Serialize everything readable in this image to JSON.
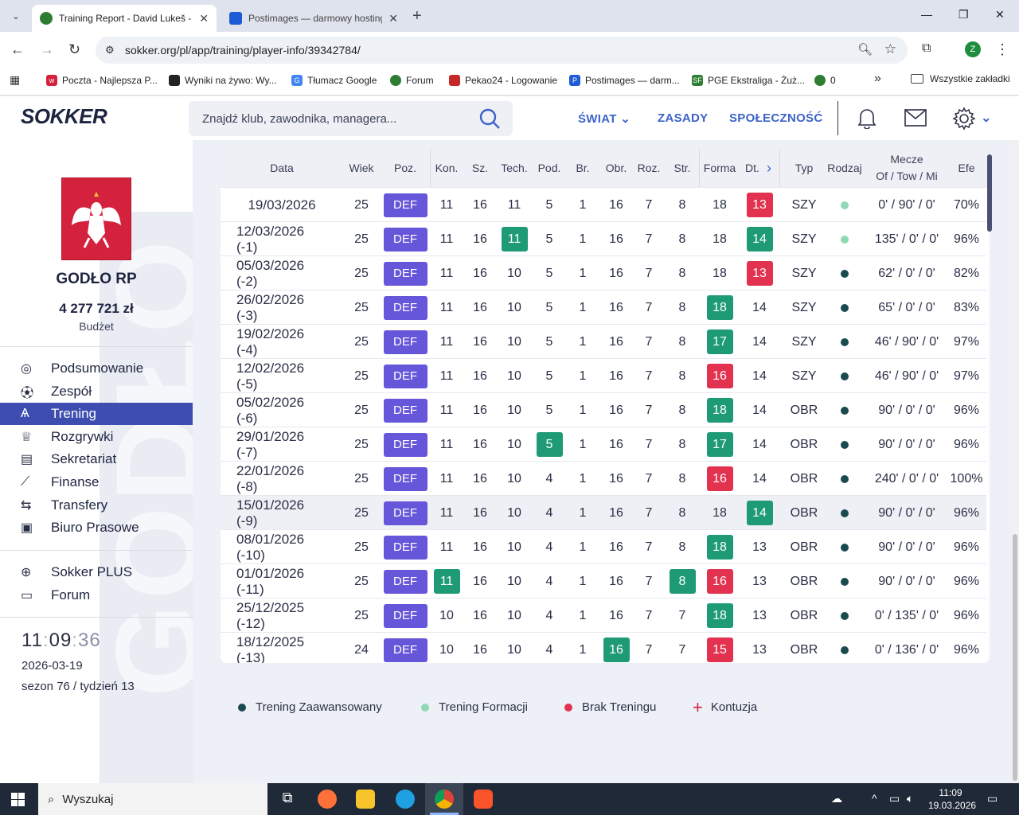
{
  "browser": {
    "tabs": [
      {
        "title": "Training Report - David Lukeš -",
        "active": true
      },
      {
        "title": "Postimages — darmowy hosting",
        "active": false
      }
    ],
    "url": "sokker.org/pl/app/training/player-info/39342784/",
    "profile_initial": "Z",
    "bookmarks": [
      {
        "label": "Poczta - Najlepsza P...",
        "color": "#d4213d",
        "icon": "mail-icon"
      },
      {
        "label": "Wyniki na żywo: Wy...",
        "color": "#222222",
        "icon": "scores-icon"
      },
      {
        "label": "Tłumacz Google",
        "color": "#4285f4",
        "icon": "translate-icon"
      },
      {
        "label": "Forum",
        "color": "#2e7d32",
        "icon": "forum-icon"
      },
      {
        "label": "Pekao24 - Logowanie",
        "color": "#c62828",
        "icon": "bank-icon"
      },
      {
        "label": "Postimages — darm...",
        "color": "#1e5bd6",
        "icon": "postimages-icon"
      },
      {
        "label": "PGE Ekstraliga - Żuż...",
        "color": "#2e7d32",
        "icon": "pge-icon"
      },
      {
        "label": "0",
        "color": "#2e7d32",
        "icon": "sokker-icon"
      }
    ],
    "all_bookmarks": "Wszystkie zakładki"
  },
  "site": {
    "logo": "SOKKER",
    "search_placeholder": "Znajdź klub, zawodnika, managera...",
    "nav": [
      "ŚWIAT",
      "ZASADY",
      "SPOŁECZNOŚĆ"
    ]
  },
  "sidebar": {
    "watermark": "GODŁO",
    "club_name": "GODŁO RP",
    "budget": "4 277 721 zł",
    "budget_label": "Budżet",
    "menu": [
      {
        "label": "Podsumowanie",
        "icon": "summary-icon",
        "active": false
      },
      {
        "label": "Zespół",
        "icon": "ball-icon",
        "active": false
      },
      {
        "label": "Trening",
        "icon": "training-icon",
        "active": true
      },
      {
        "label": "Rozgrywki",
        "icon": "trophy-icon",
        "active": false
      },
      {
        "label": "Sekretariat",
        "icon": "office-icon",
        "active": false
      },
      {
        "label": "Finanse",
        "icon": "chart-icon",
        "active": false
      },
      {
        "label": "Transfery",
        "icon": "transfer-icon",
        "active": false
      },
      {
        "label": "Biuro Prasowe",
        "icon": "press-icon",
        "active": false
      }
    ],
    "menu2": [
      {
        "label": "Sokker PLUS",
        "icon": "plus-circle-icon"
      },
      {
        "label": "Forum",
        "icon": "forum-icon"
      }
    ],
    "clock": {
      "h": "11",
      "m": "09",
      "s": "36"
    },
    "date": "2026-03-19",
    "season": "sezon 76 / tydzień 13"
  },
  "table": {
    "headers": {
      "date": "Data",
      "age": "Wiek",
      "pos": "Poz.",
      "kon": "Kon.",
      "sz": "Sz.",
      "tech": "Tech.",
      "pod": "Pod.",
      "br": "Br.",
      "obr": "Obr.",
      "roz": "Roz.",
      "str": "Str.",
      "forma": "Forma",
      "dt": "Dt.",
      "typ": "Typ",
      "rodzaj": "Rodzaj",
      "mecze": "Mecze",
      "mecze_sub": "Of / Tow / Mi",
      "efe": "Efe"
    },
    "rows": [
      {
        "date": "19/03/2026",
        "age": "25",
        "pos": "DEF",
        "kon": "11",
        "sz": "16",
        "tech": "11",
        "pod": "5",
        "br": "1",
        "obr": "16",
        "roz": "7",
        "str": "8",
        "forma": "18",
        "dt": "13",
        "typ": "SZY",
        "rodzaj": "light",
        "mecze": "0' / 90' / 0'",
        "efe": "70%",
        "hl": {
          "dt": "r"
        }
      },
      {
        "date": "12/03/2026 (-1)",
        "age": "25",
        "pos": "DEF",
        "kon": "11",
        "sz": "16",
        "tech": "11",
        "pod": "5",
        "br": "1",
        "obr": "16",
        "roz": "7",
        "str": "8",
        "forma": "18",
        "dt": "14",
        "typ": "SZY",
        "rodzaj": "light",
        "mecze": "135' / 0' / 0'",
        "efe": "96%",
        "hl": {
          "tech": "g",
          "dt": "g"
        }
      },
      {
        "date": "05/03/2026 (-2)",
        "age": "25",
        "pos": "DEF",
        "kon": "11",
        "sz": "16",
        "tech": "10",
        "pod": "5",
        "br": "1",
        "obr": "16",
        "roz": "7",
        "str": "8",
        "forma": "18",
        "dt": "13",
        "typ": "SZY",
        "rodzaj": "dark",
        "mecze": "62' / 0' / 0'",
        "efe": "82%",
        "hl": {
          "dt": "r"
        }
      },
      {
        "date": "26/02/2026 (-3)",
        "age": "25",
        "pos": "DEF",
        "kon": "11",
        "sz": "16",
        "tech": "10",
        "pod": "5",
        "br": "1",
        "obr": "16",
        "roz": "7",
        "str": "8",
        "forma": "18",
        "dt": "14",
        "typ": "SZY",
        "rodzaj": "dark",
        "mecze": "65' / 0' / 0'",
        "efe": "83%",
        "hl": {
          "forma": "g"
        }
      },
      {
        "date": "19/02/2026 (-4)",
        "age": "25",
        "pos": "DEF",
        "kon": "11",
        "sz": "16",
        "tech": "10",
        "pod": "5",
        "br": "1",
        "obr": "16",
        "roz": "7",
        "str": "8",
        "forma": "17",
        "dt": "14",
        "typ": "SZY",
        "rodzaj": "dark",
        "mecze": "46' / 90' / 0'",
        "efe": "97%",
        "hl": {
          "forma": "g"
        }
      },
      {
        "date": "12/02/2026 (-5)",
        "age": "25",
        "pos": "DEF",
        "kon": "11",
        "sz": "16",
        "tech": "10",
        "pod": "5",
        "br": "1",
        "obr": "16",
        "roz": "7",
        "str": "8",
        "forma": "16",
        "dt": "14",
        "typ": "SZY",
        "rodzaj": "dark",
        "mecze": "46' / 90' / 0'",
        "efe": "97%",
        "hl": {
          "forma": "r"
        }
      },
      {
        "date": "05/02/2026 (-6)",
        "age": "25",
        "pos": "DEF",
        "kon": "11",
        "sz": "16",
        "tech": "10",
        "pod": "5",
        "br": "1",
        "obr": "16",
        "roz": "7",
        "str": "8",
        "forma": "18",
        "dt": "14",
        "typ": "OBR",
        "rodzaj": "dark",
        "mecze": "90' / 0' / 0'",
        "efe": "96%",
        "hl": {
          "forma": "g"
        }
      },
      {
        "date": "29/01/2026 (-7)",
        "age": "25",
        "pos": "DEF",
        "kon": "11",
        "sz": "16",
        "tech": "10",
        "pod": "5",
        "br": "1",
        "obr": "16",
        "roz": "7",
        "str": "8",
        "forma": "17",
        "dt": "14",
        "typ": "OBR",
        "rodzaj": "dark",
        "mecze": "90' / 0' / 0'",
        "efe": "96%",
        "hl": {
          "pod": "g",
          "forma": "g"
        }
      },
      {
        "date": "22/01/2026 (-8)",
        "age": "25",
        "pos": "DEF",
        "kon": "11",
        "sz": "16",
        "tech": "10",
        "pod": "4",
        "br": "1",
        "obr": "16",
        "roz": "7",
        "str": "8",
        "forma": "16",
        "dt": "14",
        "typ": "OBR",
        "rodzaj": "dark",
        "mecze": "240' / 0' / 0'",
        "efe": "100%",
        "hl": {
          "forma": "r"
        }
      },
      {
        "date": "15/01/2026 (-9)",
        "age": "25",
        "pos": "DEF",
        "kon": "11",
        "sz": "16",
        "tech": "10",
        "pod": "4",
        "br": "1",
        "obr": "16",
        "roz": "7",
        "str": "8",
        "forma": "18",
        "dt": "14",
        "typ": "OBR",
        "rodzaj": "dark",
        "mecze": "90' / 0' / 0'",
        "efe": "96%",
        "hl": {
          "dt": "g"
        },
        "hover": true
      },
      {
        "date": "08/01/2026 (-10)",
        "age": "25",
        "pos": "DEF",
        "kon": "11",
        "sz": "16",
        "tech": "10",
        "pod": "4",
        "br": "1",
        "obr": "16",
        "roz": "7",
        "str": "8",
        "forma": "18",
        "dt": "13",
        "typ": "OBR",
        "rodzaj": "dark",
        "mecze": "90' / 0' / 0'",
        "efe": "96%",
        "hl": {
          "forma": "g"
        }
      },
      {
        "date": "01/01/2026 (-11)",
        "age": "25",
        "pos": "DEF",
        "kon": "11",
        "sz": "16",
        "tech": "10",
        "pod": "4",
        "br": "1",
        "obr": "16",
        "roz": "7",
        "str": "8",
        "forma": "16",
        "dt": "13",
        "typ": "OBR",
        "rodzaj": "dark",
        "mecze": "90' / 0' / 0'",
        "efe": "96%",
        "hl": {
          "kon": "g",
          "str": "g",
          "forma": "r"
        }
      },
      {
        "date": "25/12/2025 (-12)",
        "age": "25",
        "pos": "DEF",
        "kon": "10",
        "sz": "16",
        "tech": "10",
        "pod": "4",
        "br": "1",
        "obr": "16",
        "roz": "7",
        "str": "7",
        "forma": "18",
        "dt": "13",
        "typ": "OBR",
        "rodzaj": "dark",
        "mecze": "0' / 135' / 0'",
        "efe": "96%",
        "hl": {
          "forma": "g"
        }
      },
      {
        "date": "18/12/2025 (-13)",
        "age": "24",
        "pos": "DEF",
        "kon": "10",
        "sz": "16",
        "tech": "10",
        "pod": "4",
        "br": "1",
        "obr": "16",
        "roz": "7",
        "str": "7",
        "forma": "15",
        "dt": "13",
        "typ": "OBR",
        "rodzaj": "dark",
        "mecze": "0' / 136' / 0'",
        "efe": "96%",
        "hl": {
          "obr": "g",
          "forma": "r"
        }
      }
    ]
  },
  "legend": [
    {
      "label": "Trening Zaawansowany",
      "color": "#1a4a50",
      "kind": "dot"
    },
    {
      "label": "Trening Formacji",
      "color": "#8fd8b6",
      "kind": "dot"
    },
    {
      "label": "Brak Treningu",
      "color": "#e2324f",
      "kind": "dot"
    },
    {
      "label": "Kontuzja",
      "color": "#d4213d",
      "kind": "plus"
    }
  ],
  "taskbar": {
    "search": "Wyszukaj",
    "time": "11:09",
    "date": "19.03.2026"
  }
}
